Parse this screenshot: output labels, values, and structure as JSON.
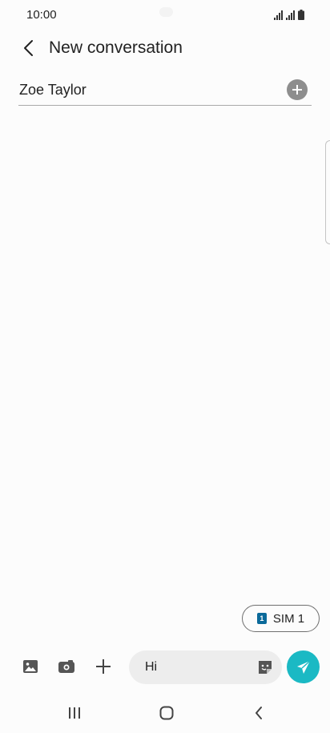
{
  "status_bar": {
    "time": "10:00",
    "icons": [
      "signal-icon",
      "signal-icon",
      "battery-icon"
    ]
  },
  "header": {
    "title": "New conversation",
    "back_icon": "chevron-left-icon"
  },
  "recipient": {
    "name": "Zoe Taylor",
    "add_icon": "plus-circle-icon"
  },
  "sim": {
    "chip_number": "1",
    "label": "SIM 1"
  },
  "composer": {
    "gallery_icon": "image-icon",
    "camera_icon": "camera-icon",
    "attach_icon": "plus-icon",
    "message_value": "Hi",
    "sticker_icon": "sticker-icon",
    "send_icon": "send-icon",
    "send_color": "#1bb9c4"
  },
  "nav_bar": {
    "recent_icon": "recent-apps-icon",
    "home_icon": "home-icon",
    "back_icon": "back-icon"
  }
}
